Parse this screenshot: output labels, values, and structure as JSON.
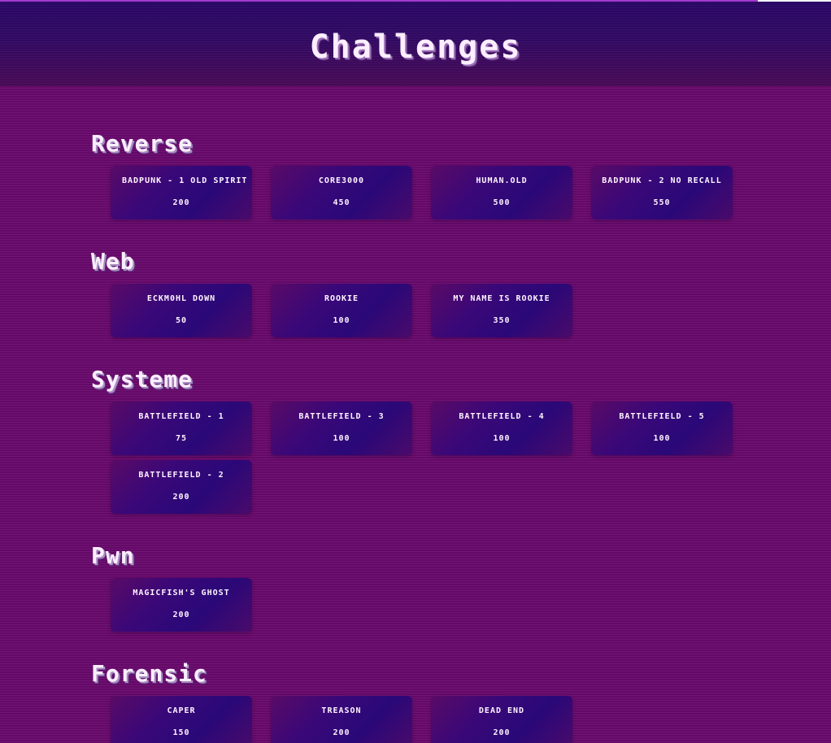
{
  "page": {
    "title": "Challenges"
  },
  "categories": [
    {
      "name": "Reverse",
      "challenges": [
        {
          "name": "Badpunk - 1 Old spirit",
          "points": "200"
        },
        {
          "name": "core3000",
          "points": "450"
        },
        {
          "name": "human.old",
          "points": "500"
        },
        {
          "name": "Badpunk - 2 No recall",
          "points": "550"
        }
      ]
    },
    {
      "name": "Web",
      "challenges": [
        {
          "name": "Eckm0hl down",
          "points": "50"
        },
        {
          "name": "Rookie",
          "points": "100"
        },
        {
          "name": "My name is Rookie",
          "points": "350"
        }
      ]
    },
    {
      "name": "Systeme",
      "challenges": [
        {
          "name": "Battlefield - 1",
          "points": "75"
        },
        {
          "name": "Battlefield - 3",
          "points": "100"
        },
        {
          "name": "Battlefield - 4",
          "points": "100"
        },
        {
          "name": "Battlefield - 5",
          "points": "100"
        },
        {
          "name": "Battlefield - 2",
          "points": "200"
        }
      ]
    },
    {
      "name": "Pwn",
      "challenges": [
        {
          "name": "Magicfish's ghost",
          "points": "200"
        }
      ]
    },
    {
      "name": "Forensic",
      "challenges": [
        {
          "name": "Caper",
          "points": "150"
        },
        {
          "name": "Treason",
          "points": "200"
        },
        {
          "name": "Dead end",
          "points": "200"
        }
      ]
    }
  ],
  "colors": {
    "background": "#6a0a6e",
    "header": "#2a0868",
    "card": "#2a0878",
    "text": "#fbeeff"
  }
}
